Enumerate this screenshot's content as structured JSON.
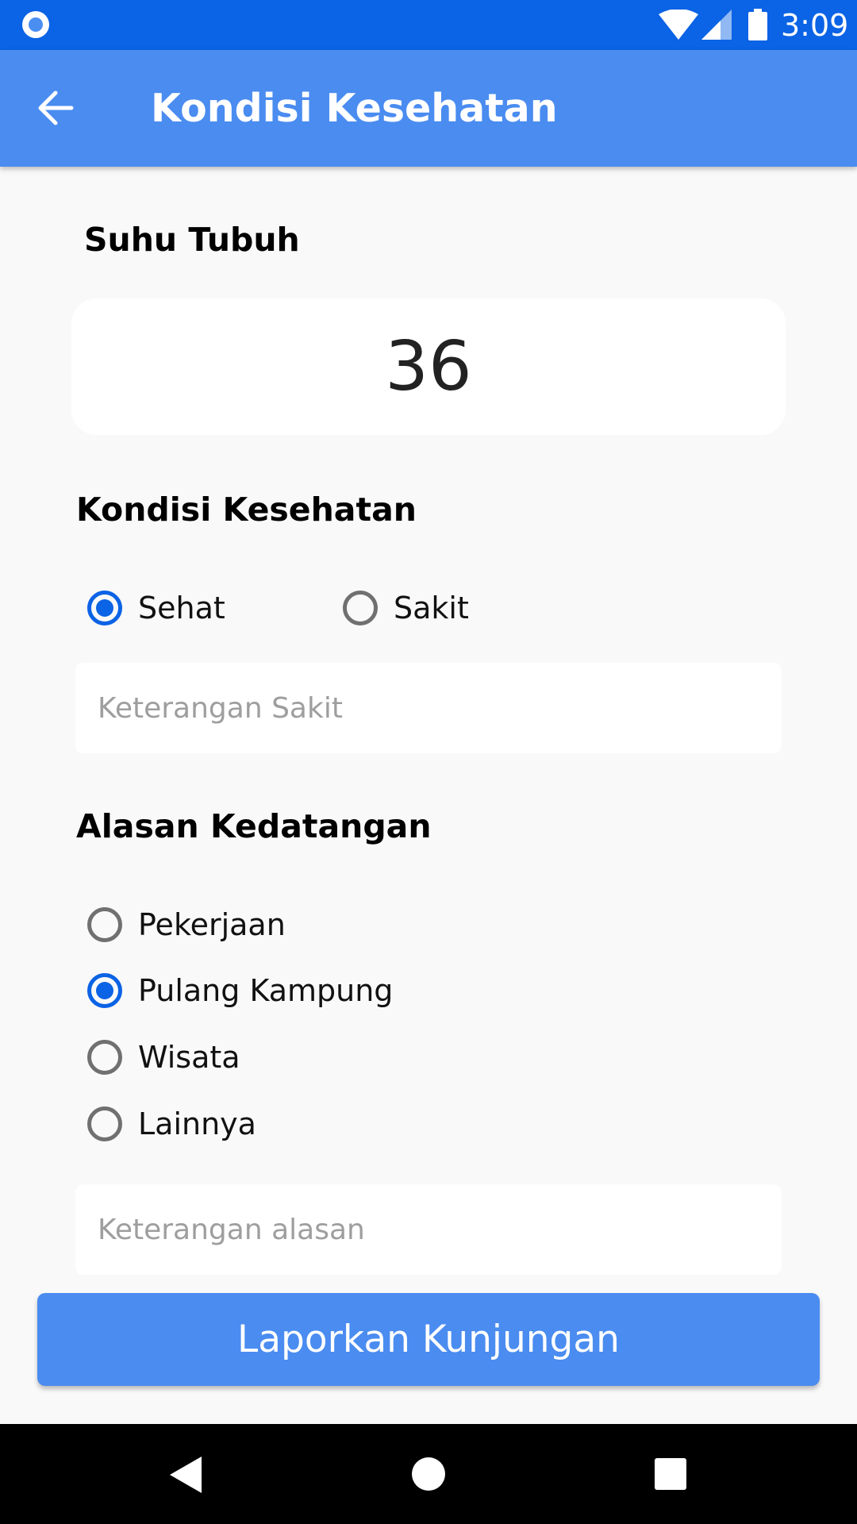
{
  "status_bar": {
    "time": "3:09",
    "icons": [
      "notification-dot-icon",
      "wifi-icon",
      "cell-signal-icon",
      "battery-icon"
    ]
  },
  "app_bar": {
    "back_icon": "arrow-back-icon",
    "title": "Kondisi Kesehatan"
  },
  "temperature": {
    "label": "Suhu Tubuh",
    "value": "36"
  },
  "health": {
    "label": "Kondisi Kesehatan",
    "options": [
      {
        "label": "Sehat",
        "checked": true
      },
      {
        "label": "Sakit",
        "checked": false
      }
    ],
    "note_placeholder": "Keterangan Sakit",
    "note_value": ""
  },
  "visit_reason": {
    "label": "Alasan Kedatangan",
    "options": [
      {
        "label": "Pekerjaan",
        "checked": false
      },
      {
        "label": "Pulang Kampung",
        "checked": true
      },
      {
        "label": "Wisata",
        "checked": false
      },
      {
        "label": "Lainnya",
        "checked": false
      }
    ],
    "note_placeholder": "Keterangan alasan",
    "note_value": ""
  },
  "submit": {
    "label": "Laporkan Kunjungan"
  },
  "nav_bar": {
    "icons": [
      "nav-back-icon",
      "nav-home-icon",
      "nav-recents-icon"
    ]
  },
  "colors": {
    "status_bar": "#0b63e5",
    "app_bar": "#4a8cf0",
    "accent": "#0b63e5",
    "background": "#f9f9f9",
    "button": "#4a8cf0"
  }
}
